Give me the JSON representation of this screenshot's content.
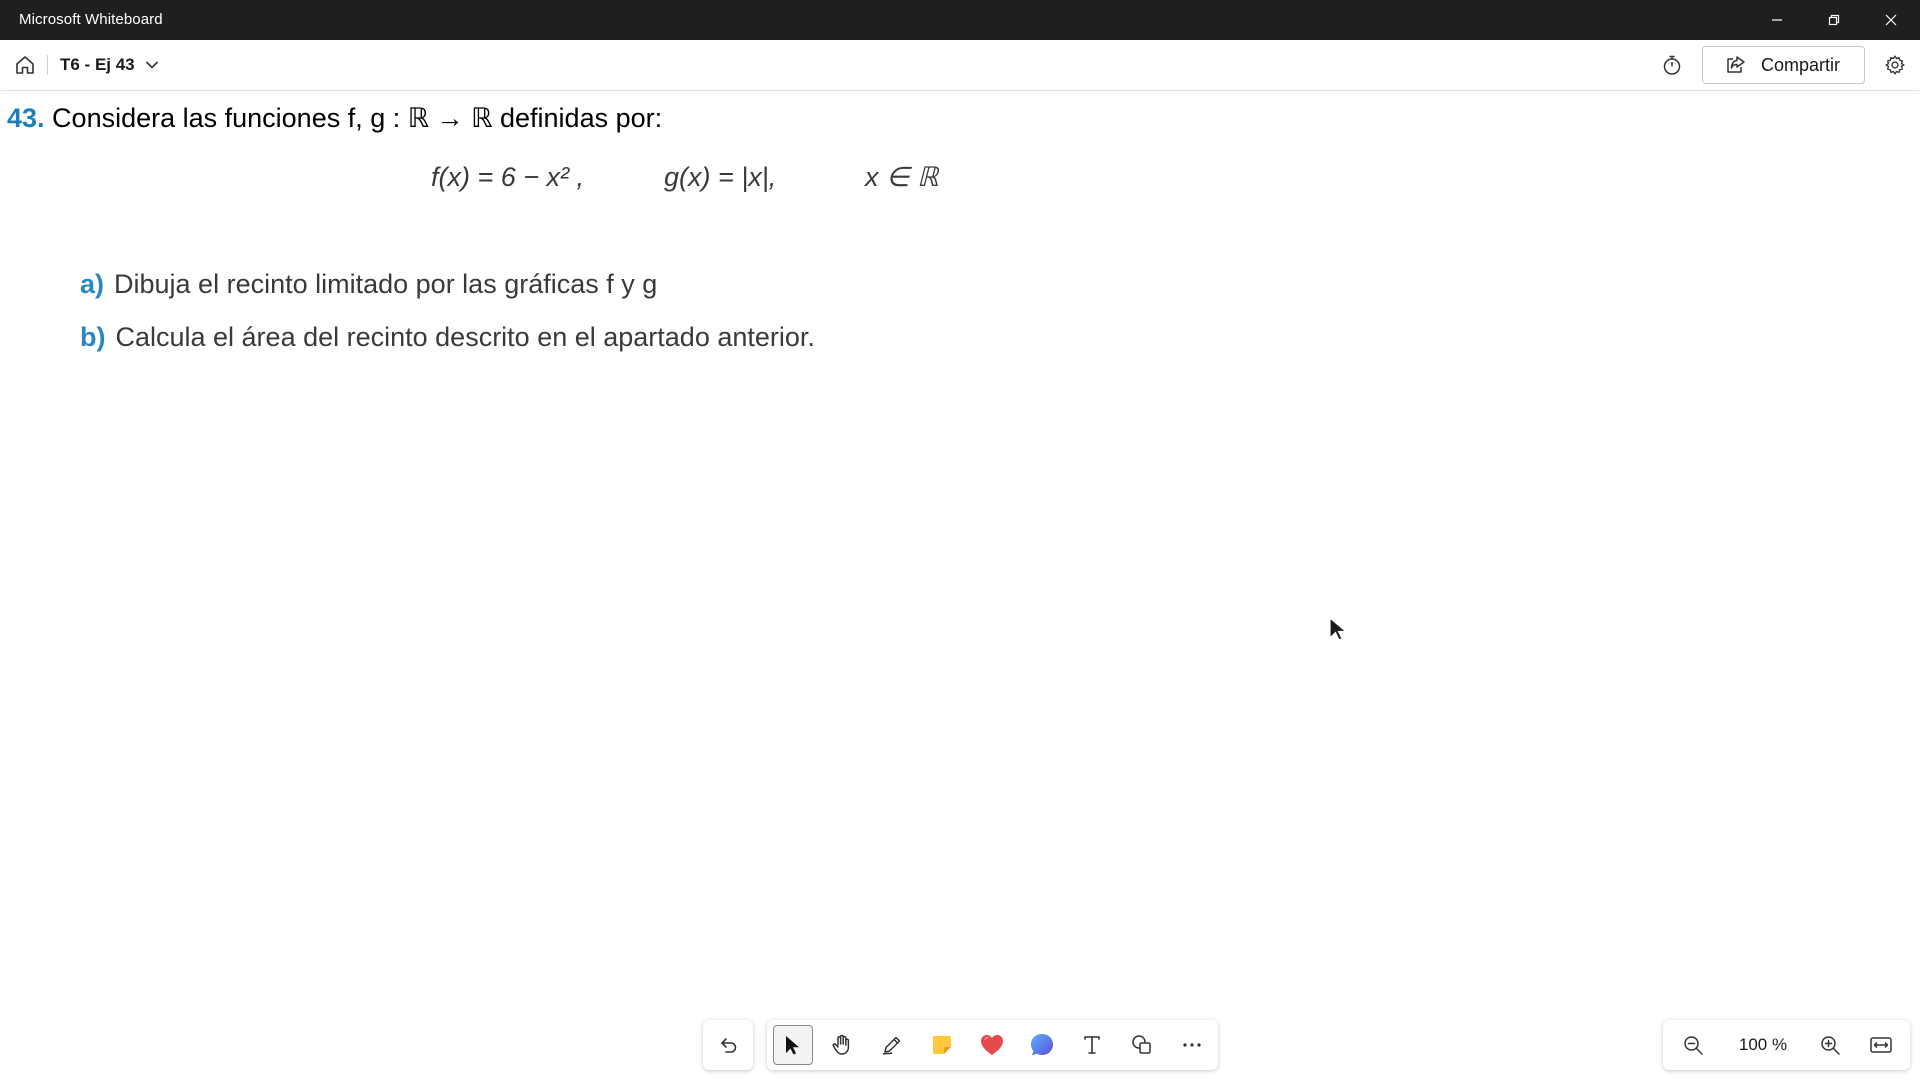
{
  "window": {
    "app_title": "Microsoft Whiteboard"
  },
  "header": {
    "board_title": "T6 - Ej 43",
    "share_label": "Compartir"
  },
  "problem": {
    "number": "43.",
    "statement": " Considera las funciones f, g : ℝ → ℝ definidas por:",
    "eq_f": "f(x) = 6 − x² ,",
    "eq_g": "g(x) = |x|,",
    "eq_domain": "x ∈ ℝ",
    "part_a_label": "a)",
    "part_a_text": "Dibuja el recinto limitado por las gráficas f y g",
    "part_b_label": "b)",
    "part_b_text": "Calcula el área del recinto descrito en el apartado anterior."
  },
  "toolbar": {
    "tools": [
      "undo-icon",
      "select-icon",
      "hand-icon",
      "pen-icon",
      "sticky-note-icon",
      "heart-reaction-icon",
      "chat-bubble-icon",
      "text-icon",
      "shapes-icon",
      "more-icon"
    ],
    "active_tool": "select"
  },
  "zoom": {
    "level": "100 %"
  },
  "colors": {
    "titlebar": "#1f1f1f",
    "accent_blue": "#1e7fb8",
    "sticky_note": "#ffc83d",
    "heart": "#e5484d",
    "bubble": "#3b7be0"
  }
}
